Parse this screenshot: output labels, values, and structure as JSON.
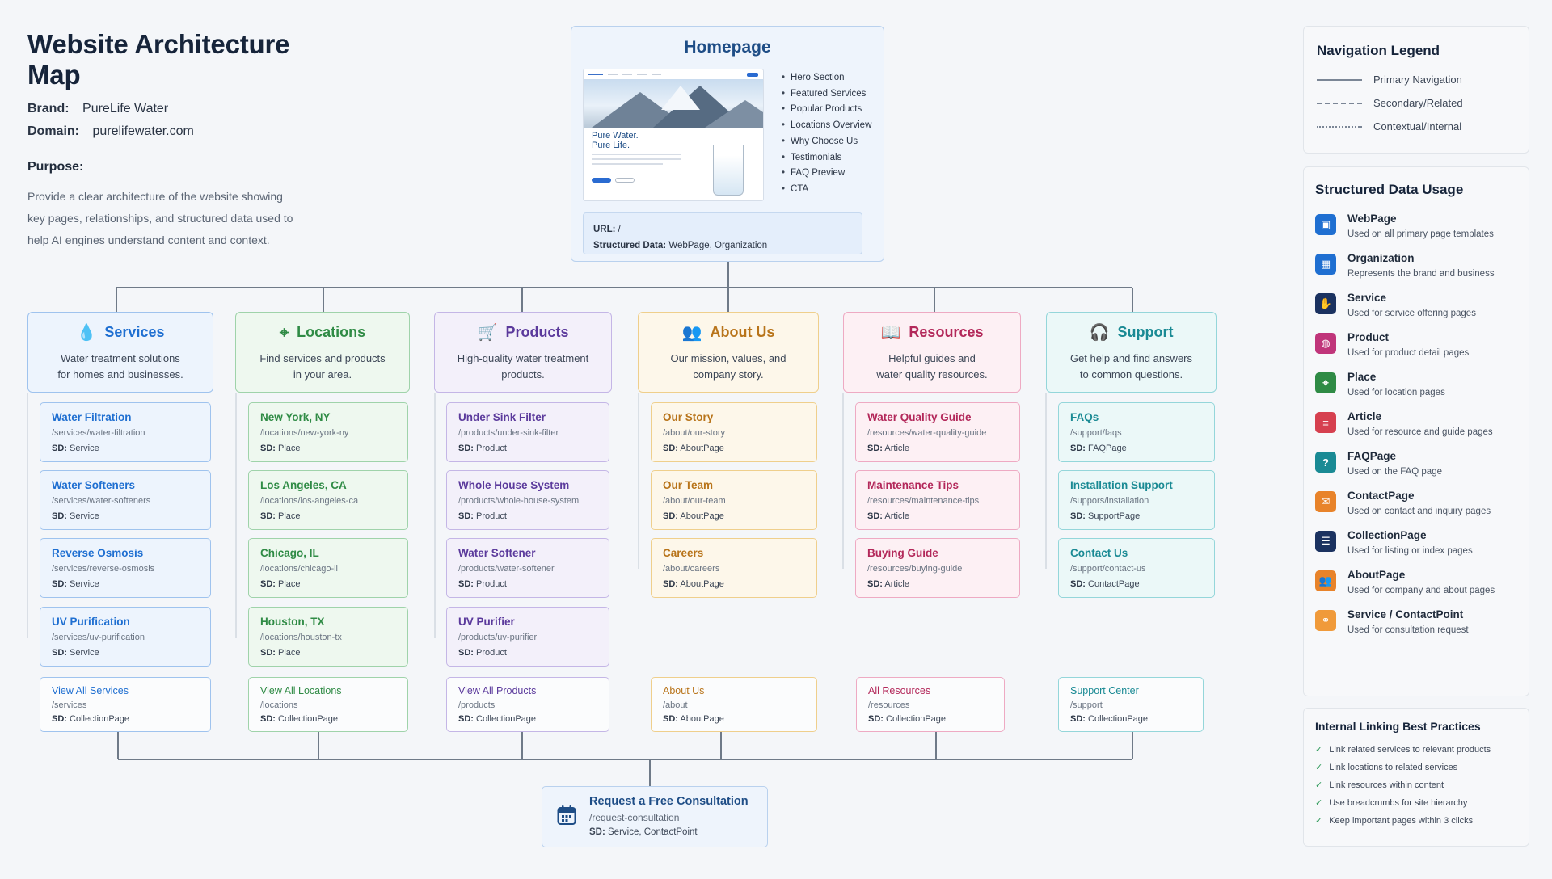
{
  "header": {
    "title": "Website Architecture Map",
    "brand_label": "Brand:",
    "brand": "PureLife Water",
    "domain_label": "Domain:",
    "domain": "purelifewater.com",
    "purpose_label": "Purpose:",
    "purpose": "Provide a clear architecture of the website showing key pages, relationships, and structured data used to help AI engines understand content and context."
  },
  "homepage": {
    "title": "Homepage",
    "preview_tagline_1": "Pure Water.",
    "preview_tagline_2": "Pure Life.",
    "sections": [
      "Hero Section",
      "Featured Services",
      "Popular Products",
      "Locations Overview",
      "Why Choose Us",
      "Testimonials",
      "FAQ Preview",
      "CTA"
    ],
    "url_label": "URL:",
    "url": "/",
    "sd_label": "Structured Data:",
    "sd": "WebPage, Organization"
  },
  "sd_prefix": "SD:",
  "categories": [
    {
      "key": "services",
      "title": "Services",
      "icon": "water-drop-icon",
      "glyph": "💧",
      "accent": "#1f6fd1",
      "bg": "#edf4fd",
      "border": "#9fc3ee",
      "desc_1": "Water treatment solutions",
      "desc_2": "for homes and businesses.",
      "children": [
        {
          "title": "Water Filtration",
          "url": "/services/water-filtration",
          "sd": "Service"
        },
        {
          "title": "Water Softeners",
          "url": "/services/water-softeners",
          "sd": "Service"
        },
        {
          "title": "Reverse Osmosis",
          "url": "/services/reverse-osmosis",
          "sd": "Service"
        },
        {
          "title": "UV Purification",
          "url": "/services/uv-purification",
          "sd": "Service"
        }
      ],
      "index": {
        "title": "View All Services",
        "url": "/services",
        "sd": "CollectionPage"
      }
    },
    {
      "key": "locations",
      "title": "Locations",
      "icon": "map-pin-icon",
      "glyph": "⌖",
      "accent": "#2f8b45",
      "bg": "#eef8ef",
      "border": "#9fd3aa",
      "desc_1": "Find services and products",
      "desc_2": "in your area.",
      "children": [
        {
          "title": "New York, NY",
          "url": "/locations/new-york-ny",
          "sd": "Place"
        },
        {
          "title": "Los Angeles, CA",
          "url": "/locations/los-angeles-ca",
          "sd": "Place"
        },
        {
          "title": "Chicago, IL",
          "url": "/locations/chicago-il",
          "sd": "Place"
        },
        {
          "title": "Houston, TX",
          "url": "/locations/houston-tx",
          "sd": "Place"
        }
      ],
      "index": {
        "title": "View All Locations",
        "url": "/locations",
        "sd": "CollectionPage"
      }
    },
    {
      "key": "products",
      "title": "Products",
      "icon": "shopping-cart-icon",
      "glyph": "🛒",
      "accent": "#5b3a9c",
      "bg": "#f3f0fa",
      "border": "#c4b6e6",
      "desc_1": "High-quality water treatment",
      "desc_2": "products.",
      "children": [
        {
          "title": "Under Sink Filter",
          "url": "/products/under-sink-filter",
          "sd": "Product"
        },
        {
          "title": "Whole House System",
          "url": "/products/whole-house-system",
          "sd": "Product"
        },
        {
          "title": "Water Softener",
          "url": "/products/water-softener",
          "sd": "Product"
        },
        {
          "title": "UV Purifier",
          "url": "/products/uv-purifier",
          "sd": "Product"
        }
      ],
      "index": {
        "title": "View All Products",
        "url": "/products",
        "sd": "CollectionPage"
      }
    },
    {
      "key": "about",
      "title": "About Us",
      "icon": "people-icon",
      "glyph": "👥",
      "accent": "#b8741a",
      "bg": "#fdf7ea",
      "border": "#efcf8c",
      "desc_1": "Our mission, values, and",
      "desc_2": "company story.",
      "children": [
        {
          "title": "Our Story",
          "url": "/about/our-story",
          "sd": "AboutPage"
        },
        {
          "title": "Our Team",
          "url": "/about/our-team",
          "sd": "AboutPage"
        },
        {
          "title": "Careers",
          "url": "/about/careers",
          "sd": "AboutPage"
        }
      ],
      "index": {
        "title": "About Us",
        "url": "/about",
        "sd": "AboutPage"
      }
    },
    {
      "key": "resources",
      "title": "Resources",
      "icon": "book-icon",
      "glyph": "📖",
      "accent": "#b3285a",
      "bg": "#fdf0f4",
      "border": "#eeaac3",
      "desc_1": "Helpful guides and",
      "desc_2": "water quality resources.",
      "children": [
        {
          "title": "Water Quality Guide",
          "url": "/resources/water-quality-guide",
          "sd": "Article"
        },
        {
          "title": "Maintenance Tips",
          "url": "/resources/maintenance-tips",
          "sd": "Article"
        },
        {
          "title": "Buying Guide",
          "url": "/resources/buying-guide",
          "sd": "Article"
        }
      ],
      "index": {
        "title": "All Resources",
        "url": "/resources",
        "sd": "CollectionPage"
      }
    },
    {
      "key": "support",
      "title": "Support",
      "icon": "headset-icon",
      "glyph": "🎧",
      "accent": "#1a8a94",
      "bg": "#ebf8f8",
      "border": "#94d6da",
      "desc_1": "Get help and find answers",
      "desc_2": "to common questions.",
      "children": [
        {
          "title": "FAQs",
          "url": "/support/faqs",
          "sd": "FAQPage"
        },
        {
          "title": "Installation Support",
          "url": "/suppors/installation",
          "sd": "SupportPage"
        },
        {
          "title": "Contact Us",
          "url": "/support/contact-us",
          "sd": "ContactPage"
        }
      ],
      "index": {
        "title": "Support Center",
        "url": "/support",
        "sd": "CollectionPage"
      }
    }
  ],
  "consultation": {
    "title": "Request a Free Consultation",
    "url": "/request-consultation",
    "sd": "Service, ContactPoint",
    "icon": "calendar-icon"
  },
  "legend": {
    "title": "Navigation Legend",
    "items": [
      {
        "label": "Primary Navigation",
        "style": "solid"
      },
      {
        "label": "Secondary/Related",
        "style": "dashed"
      },
      {
        "label": "Contextual/Internal",
        "style": "dotted"
      }
    ]
  },
  "structured_data": {
    "title": "Structured Data Usage",
    "items": [
      {
        "name": "WebPage",
        "desc": "Used on all primary page templates",
        "icon": "webpage-icon",
        "glyph": "▣",
        "color": "#1f6fd1"
      },
      {
        "name": "Organization",
        "desc": "Represents the brand and business",
        "icon": "building-icon",
        "glyph": "▦",
        "color": "#1f6fd1"
      },
      {
        "name": "Service",
        "desc": "Used for service offering pages",
        "icon": "hand-icon",
        "glyph": "✋",
        "color": "#1b3260"
      },
      {
        "name": "Product",
        "desc": "Used for product detail pages",
        "icon": "bag-icon",
        "glyph": "◍",
        "color": "#c0357a"
      },
      {
        "name": "Place",
        "desc": "Used for location pages",
        "icon": "map-pin-icon",
        "glyph": "⌖",
        "color": "#2f8b45"
      },
      {
        "name": "Article",
        "desc": "Used for resource and guide pages",
        "icon": "document-icon",
        "glyph": "≡",
        "color": "#d6404f"
      },
      {
        "name": "FAQPage",
        "desc": "Used on the FAQ page",
        "icon": "question-icon",
        "glyph": "?",
        "color": "#1a8a94"
      },
      {
        "name": "ContactPage",
        "desc": "Used on contact and inquiry pages",
        "icon": "mail-icon",
        "glyph": "✉",
        "color": "#e8832a"
      },
      {
        "name": "CollectionPage",
        "desc": "Used for listing or index pages",
        "icon": "list-icon",
        "glyph": "☰",
        "color": "#1b3260"
      },
      {
        "name": "AboutPage",
        "desc": "Used for company and about pages",
        "icon": "people-icon",
        "glyph": "👥",
        "color": "#e8832a"
      },
      {
        "name": "Service / ContactPoint",
        "desc": "Used for consultation request",
        "icon": "link-icon",
        "glyph": "⚭",
        "color": "#f09a3a"
      }
    ]
  },
  "best_practices": {
    "title": "Internal Linking Best Practices",
    "check_icon": "check-icon",
    "items": [
      "Link related services to relevant products",
      "Link locations to related services",
      "Link resources within content",
      "Use breadcrumbs for site hierarchy",
      "Keep important pages within 3 clicks"
    ]
  }
}
